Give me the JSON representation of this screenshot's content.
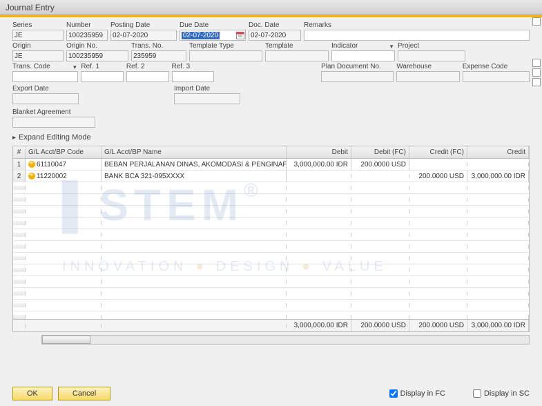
{
  "window": {
    "title": "Journal Entry"
  },
  "labels": {
    "series": "Series",
    "number": "Number",
    "posting_date": "Posting Date",
    "due_date": "Due Date",
    "doc_date": "Doc. Date",
    "remarks": "Remarks",
    "origin": "Origin",
    "origin_no": "Origin No.",
    "trans_no": "Trans. No.",
    "template_type": "Template Type",
    "template": "Template",
    "indicator": "Indicator",
    "project": "Project",
    "trans_code": "Trans. Code",
    "ref1": "Ref. 1",
    "ref2": "Ref. 2",
    "ref3": "Ref. 3",
    "plan_doc_no": "Plan Document No.",
    "warehouse": "Warehouse",
    "expense_code": "Expense Code",
    "export_date": "Export Date",
    "import_date": "Import Date",
    "blanket_agreement": "Blanket Agreement",
    "expand": "Expand Editing Mode",
    "display_fc": "Display in FC",
    "display_sc": "Display in SC",
    "ok": "OK",
    "cancel": "Cancel"
  },
  "header": {
    "series": "JE",
    "number": "100235959",
    "posting_date": "02-07-2020",
    "due_date": "02-07-2020",
    "doc_date": "02-07-2020",
    "remarks": "",
    "origin": "JE",
    "origin_no": "100235959",
    "trans_no": "235959",
    "template_type": "",
    "template": "",
    "indicator": "",
    "project": "",
    "trans_code": "",
    "ref1": "",
    "ref2": "",
    "ref3": "",
    "plan_doc_no": "",
    "warehouse": "",
    "expense_code": "",
    "export_date": "",
    "import_date": "",
    "blanket_agreement": ""
  },
  "grid": {
    "columns": {
      "row": "#",
      "code": "G/L Acct/BP Code",
      "name": "G/L Acct/BP Name",
      "debit": "Debit",
      "debit_fc": "Debit (FC)",
      "credit_fc": "Credit (FC)",
      "credit": "Credit"
    },
    "rows": [
      {
        "n": "1",
        "code": "61110047",
        "name": "BEBAN PERJALANAN DINAS, AKOMODASI & PENGINAPAN",
        "debit": "3,000,000.00 IDR",
        "debit_fc": "200.0000 USD",
        "credit_fc": "",
        "credit": ""
      },
      {
        "n": "2",
        "code": "11220002",
        "name": "BANK BCA 321-095XXXX",
        "debit": "",
        "debit_fc": "",
        "credit_fc": "200.0000 USD",
        "credit": "3,000,000.00 IDR"
      }
    ],
    "totals": {
      "debit": "3,000,000.00 IDR",
      "debit_fc": "200.0000 USD",
      "credit_fc": "200.0000 USD",
      "credit": "3,000,000.00 IDR"
    }
  },
  "footer": {
    "display_fc": true,
    "display_sc": false
  },
  "watermark": {
    "brand": "STEM",
    "tagline_a": "INNOVATION",
    "tagline_b": "DESIGN",
    "tagline_c": "VALUE"
  },
  "colors": {
    "accent": "#ffb300",
    "selected": "#316ac5"
  }
}
